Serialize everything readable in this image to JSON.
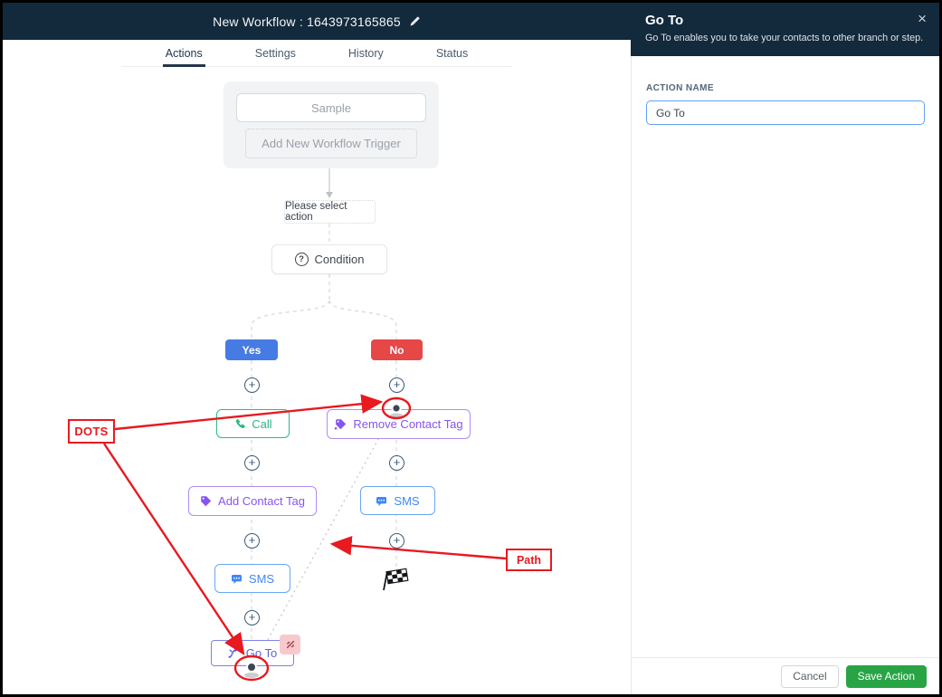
{
  "header": {
    "title": "New Workflow : 1643973165865"
  },
  "tabs": {
    "actions": "Actions",
    "settings": "Settings",
    "history": "History",
    "status": "Status"
  },
  "canvas": {
    "trigger_sample": "Sample",
    "trigger_add": "Add New Workflow Trigger",
    "select_action": "Please select action",
    "condition": "Condition",
    "branch_yes": "Yes",
    "branch_no": "No",
    "nodes": {
      "call": "Call",
      "remove_contact_tag": "Remove Contact Tag",
      "add_contact_tag": "Add Contact Tag",
      "sms_no": "SMS",
      "sms_yes": "SMS",
      "go_to": "Go To"
    },
    "annotations": {
      "dots": "DOTS",
      "path": "Path"
    }
  },
  "panel": {
    "title": "Go To",
    "subtitle": "Go To enables you to take your contacts to other branch or step.",
    "action_name_label": "ACTION NAME",
    "action_name_value": "Go To",
    "cancel": "Cancel",
    "save": "Save Action"
  },
  "icons": {
    "plus": "+",
    "close": "×",
    "question": "?"
  },
  "colors": {
    "navy": "#13293c",
    "yes_blue": "#477be4",
    "no_red": "#e64747",
    "call_green": "#2eb885",
    "tag_purple": "#8655f0",
    "sms_blue": "#3f87f5",
    "goto_indigo": "#5b5fd9",
    "save_green": "#28a445",
    "annotation_red": "#e8191f"
  }
}
